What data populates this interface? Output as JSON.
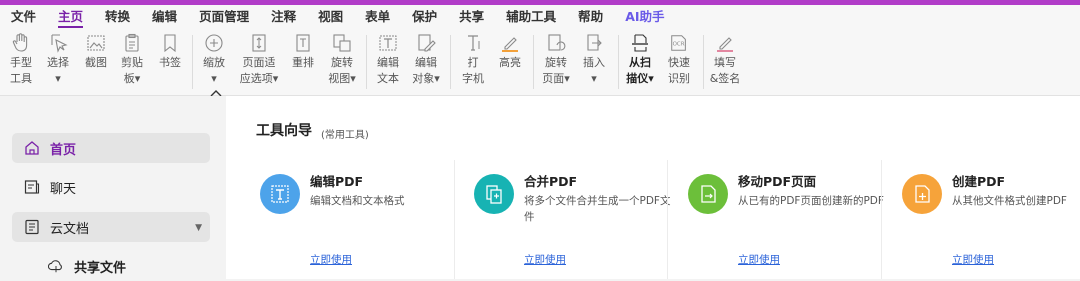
{
  "menu": {
    "items": [
      "文件",
      "主页",
      "转换",
      "编辑",
      "页面管理",
      "注释",
      "视图",
      "表单",
      "保护",
      "共享",
      "辅助工具",
      "帮助",
      "AI助手"
    ],
    "active": "主页"
  },
  "ribbon": {
    "hand": [
      "手型",
      "工具"
    ],
    "select": [
      "选择",
      "▾"
    ],
    "screenshot": [
      "截图",
      ""
    ],
    "clipboard": [
      "剪贴",
      "板▾"
    ],
    "bookmark": [
      "书签",
      ""
    ],
    "zoom": [
      "缩放",
      "▾"
    ],
    "fit": [
      "页面适",
      "应选项▾"
    ],
    "reflow": [
      "重排",
      ""
    ],
    "rotate_view": [
      "旋转",
      "视图▾"
    ],
    "edit_text": [
      "编辑",
      "文本"
    ],
    "edit_object": [
      "编辑",
      "对象▾"
    ],
    "typewriter": [
      "打",
      "字机"
    ],
    "highlight": [
      "高亮",
      ""
    ],
    "rotate_page": [
      "旋转",
      "页面▾"
    ],
    "insert": [
      "插入",
      "▾"
    ],
    "scan": [
      "从扫",
      "描仪▾"
    ],
    "ocr": [
      "快速",
      "识别"
    ],
    "fill_sign": [
      "填写",
      "&签名"
    ]
  },
  "sidebar": {
    "items": [
      {
        "label": "首页",
        "icon": "home-icon"
      },
      {
        "label": "聊天",
        "icon": "chat-icon"
      },
      {
        "label": "云文档",
        "icon": "cloud-doc-icon"
      },
      {
        "label": "共享文件",
        "icon": "shared-files-icon"
      }
    ]
  },
  "main": {
    "title": "工具向导",
    "subtitle": "(常用工具)",
    "cards": [
      {
        "title": "编辑PDF",
        "desc": "编辑文档和文本格式",
        "link": "立即使用",
        "color": "#4da3ea"
      },
      {
        "title": "合并PDF",
        "desc": "将多个文件合并生成一个PDF文件",
        "link": "立即使用",
        "color": "#17b3b3"
      },
      {
        "title": "移动PDF页面",
        "desc": "从已有的PDF页面创建新的PDF",
        "link": "立即使用",
        "color": "#6cbf3a"
      },
      {
        "title": "创建PDF",
        "desc": "从其他文件格式创建PDF",
        "link": "立即使用",
        "color": "#f6a33a"
      }
    ]
  },
  "colors": {
    "accent": "#7a22a8",
    "topbar": "#b13cc8",
    "link": "#2b63d9"
  }
}
